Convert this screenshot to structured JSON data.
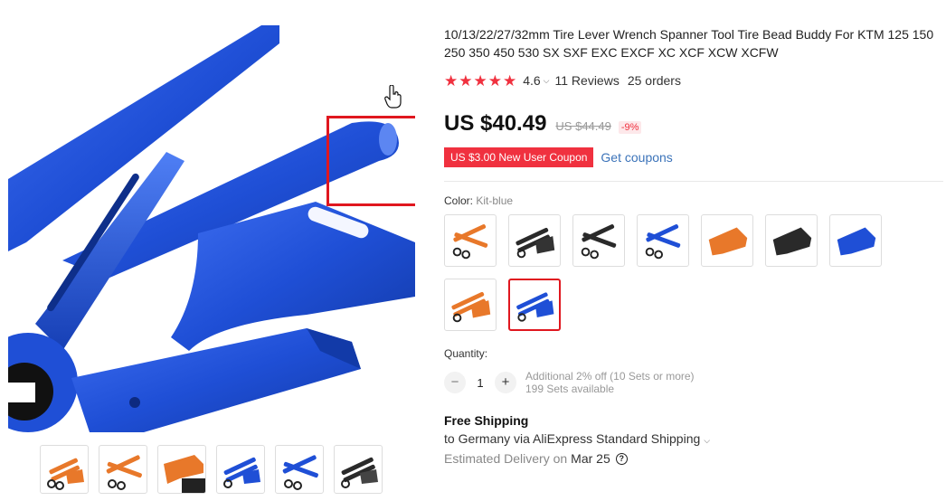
{
  "product": {
    "title": "10/13/22/27/32mm Tire Lever Wrench Spanner Tool Tire Bead Buddy For KTM 125 150 250 350 450 530 SX SXF EXC EXCF XC XCF XCW XCFW",
    "stars": "★★★★★",
    "rating": "4.6",
    "reviews": "11 Reviews",
    "orders": "25 orders"
  },
  "price": {
    "current": "US $40.49",
    "original": "US $44.49",
    "discount": "-9%"
  },
  "coupon": {
    "label": "US $3.00 New User Coupon",
    "link": "Get coupons"
  },
  "color": {
    "label": "Color:",
    "selected": "Kit-blue",
    "options": [
      {
        "variant": "orange-levers"
      },
      {
        "variant": "black-kit"
      },
      {
        "variant": "black-levers"
      },
      {
        "variant": "blue-levers"
      },
      {
        "variant": "orange-stand"
      },
      {
        "variant": "black-stand"
      },
      {
        "variant": "blue-stand"
      },
      {
        "variant": "orange-kit"
      },
      {
        "variant": "blue-kit",
        "selected": true
      }
    ]
  },
  "quantity": {
    "label": "Quantity:",
    "value": "1",
    "minus": "−",
    "plus": "+",
    "bulk_note": "Additional 2% off (10 Sets or more)",
    "available": "199 Sets available"
  },
  "shipping": {
    "title": "Free Shipping",
    "destination": "to Germany via AliExpress Standard Shipping",
    "delivery_label": "Estimated Delivery on",
    "delivery_date": "Mar 25",
    "help": "?"
  },
  "gallery": {
    "thumbnails": [
      "orange-kit",
      "orange-levers",
      "orange-stand",
      "blue-kit",
      "blue-levers",
      "black-kit"
    ]
  },
  "colors": {
    "accent": "#f0313f",
    "link": "#3b73b9",
    "blue_tool": "#1f4fd6",
    "orange_tool": "#e8782a",
    "black_tool": "#2a2a2a",
    "highlight": "#e0171f"
  }
}
